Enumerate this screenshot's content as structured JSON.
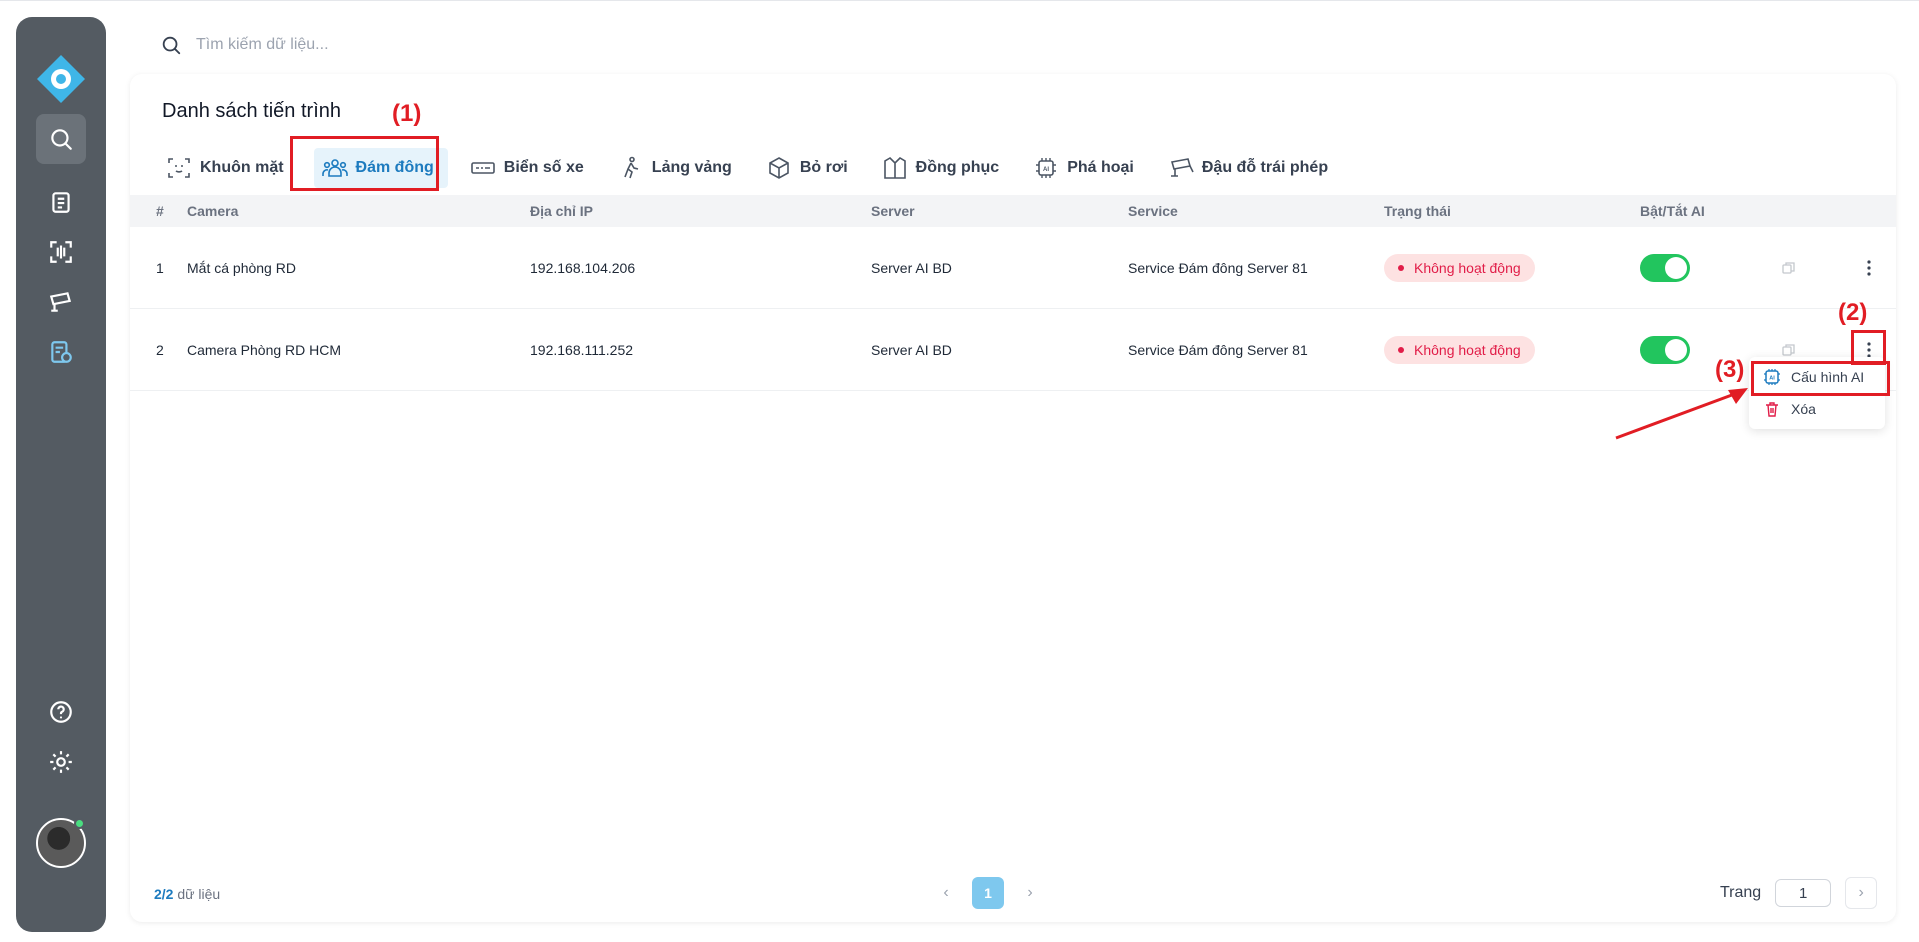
{
  "search": {
    "placeholder": "Tìm kiếm dữ liệu..."
  },
  "panel": {
    "title": "Danh sách tiến trình"
  },
  "tabs": [
    {
      "label": "Khuôn mặt",
      "icon": "face-scan-icon"
    },
    {
      "label": "Đám đông",
      "icon": "crowd-icon",
      "active": true
    },
    {
      "label": "Biển số xe",
      "icon": "license-plate-icon"
    },
    {
      "label": "Lảng vảng",
      "icon": "walking-icon"
    },
    {
      "label": "Bỏ rơi",
      "icon": "box-icon"
    },
    {
      "label": "Đồng phục",
      "icon": "uniform-icon"
    },
    {
      "label": "Phá hoại",
      "icon": "ai-chip-icon"
    },
    {
      "label": "Đậu đỗ trái phép",
      "icon": "cctv-icon"
    }
  ],
  "table": {
    "headers": [
      "#",
      "Camera",
      "Địa chỉ IP",
      "Server",
      "Service",
      "Trạng thái",
      "Bật/Tắt AI"
    ],
    "rows": [
      {
        "idx": "1",
        "camera": "Mắt cá phòng RD",
        "ip": "192.168.104.206",
        "server": "Server AI BD",
        "service": "Service Đám đông Server 81",
        "status": "Không hoạt động",
        "ai_on": true
      },
      {
        "idx": "2",
        "camera": "Camera Phòng RD HCM",
        "ip": "192.168.111.252",
        "server": "Server AI BD",
        "service": "Service Đám đông Server 81",
        "status": "Không hoạt động",
        "ai_on": true
      }
    ]
  },
  "context_menu": {
    "items": [
      "Cấu hình AI",
      "Xóa"
    ]
  },
  "footer": {
    "count_current": "2",
    "count_total": "/2",
    "count_suffix": " dữ liệu",
    "page": "1",
    "goto_label": "Trang",
    "goto_value": "1"
  },
  "annotations": [
    "(1)",
    "(2)",
    "(3)"
  ],
  "colors": {
    "sidebar": "#545b62",
    "accent": "#1d7bbf",
    "toggle_on": "#22c55e",
    "status_bad": "#e11d48",
    "annotation": "#e11d24"
  }
}
